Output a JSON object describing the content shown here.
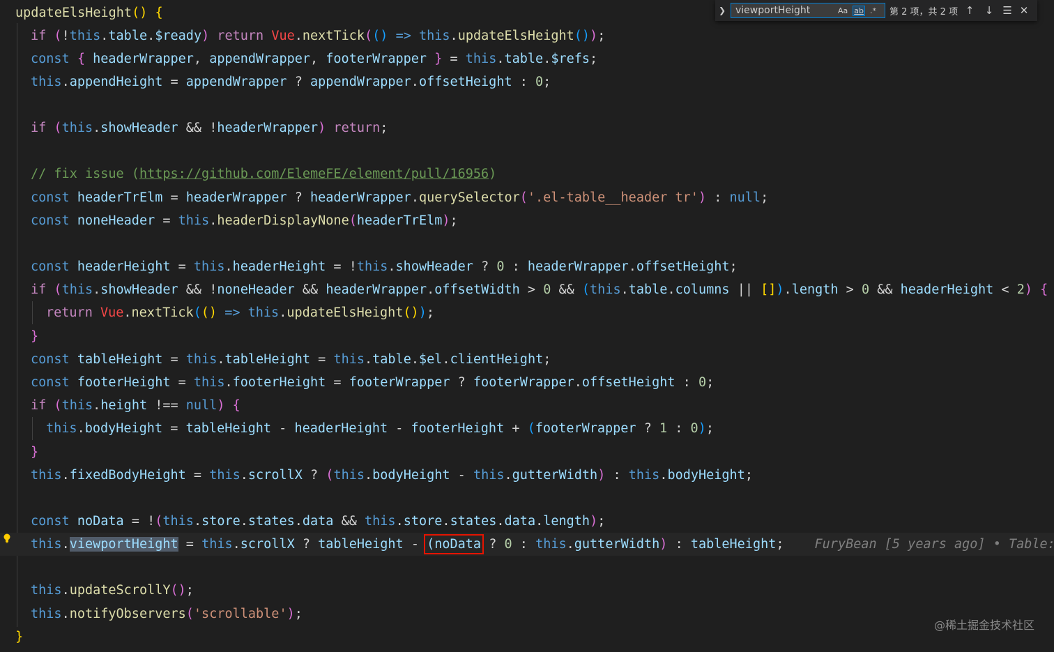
{
  "find_widget": {
    "query": "viewportHeight",
    "match_case_label": "Aa",
    "whole_word_label": "ab",
    "regex_label": ".*",
    "match_count": "第 2 项，共 2 项",
    "expand_icon": "chevron-right-icon",
    "prev_icon": "arrow-up-icon",
    "next_icon": "arrow-down-icon",
    "selection_icon": "find-in-selection-icon",
    "close_icon": "close-icon"
  },
  "code": {
    "l1_name": "updateElsHeight",
    "l2_ready": "$ready",
    "l2_vue": "Vue",
    "l2_nexttick": "nextTick",
    "l2_call": "updateElsHeight",
    "comment_prefix": "// fix issue (",
    "comment_url": "https://github.com/ElemeFE/element/pull/16956",
    "comment_suffix": ")",
    "selector_string": "'.el-table__header tr'",
    "scrollable_string": "'scrollable'",
    "highlight_ident": "viewportHeight",
    "boxed_ident": "(noData"
  },
  "blame": {
    "text": "FuryBean [5 years ago] • Table: "
  },
  "watermark": "@稀土掘金技术社区",
  "colors": {
    "background": "#1f1f1f",
    "keyword": "#569cd6",
    "function": "#dcdcaa",
    "variable": "#9cdcfe",
    "string": "#ce9178",
    "number": "#b5cea8",
    "comment": "#6a9955",
    "box": "#e51400"
  }
}
